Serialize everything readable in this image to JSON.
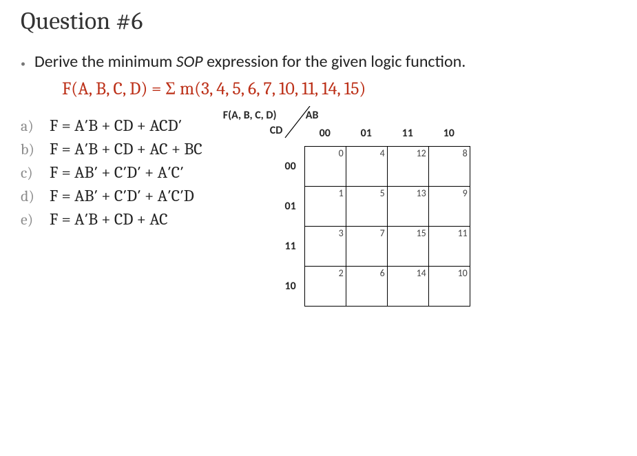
{
  "title": "Question #6",
  "instruction_pre": "Derive the minimum ",
  "instruction_em": "SOP",
  "instruction_post": " expression for the given logic function.",
  "equation": "F(A, B, C, D)  =  Σ m(3, 4, 5, 6, 7, 10, 11, 14, 15)",
  "choices": [
    {
      "letter": "a)",
      "expr": "F = A′B + CD + ACD′"
    },
    {
      "letter": "b)",
      "expr": "F = A′B + CD + AC + BC"
    },
    {
      "letter": "c)",
      "expr": "F = AB′ + C′D′ + A′C′"
    },
    {
      "letter": "d)",
      "expr": "F = AB′ + C′D′ + A′C′D"
    },
    {
      "letter": "e)",
      "expr": "F = A′B + CD + AC"
    }
  ],
  "kmap": {
    "fn_label": "F(A, B, C, D)",
    "col_var": "AB",
    "row_var": "CD",
    "col_headers": [
      "00",
      "01",
      "11",
      "10"
    ],
    "row_headers": [
      "00",
      "01",
      "11",
      "10"
    ],
    "cells": [
      [
        "0",
        "4",
        "12",
        "8"
      ],
      [
        "1",
        "5",
        "13",
        "9"
      ],
      [
        "3",
        "7",
        "15",
        "11"
      ],
      [
        "2",
        "6",
        "14",
        "10"
      ]
    ]
  }
}
